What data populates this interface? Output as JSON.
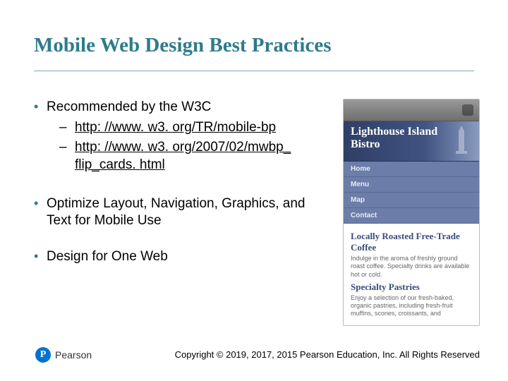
{
  "title": "Mobile Web Design Best Practices",
  "bullets": {
    "b1": {
      "text": "Recommended by the W3C",
      "links": {
        "l1": "http: //www. w3. org/TR/mobile-bp",
        "l2a": "http: //www. w3. org/2007/02/mwbp_",
        "l2b": "flip_cards. html"
      }
    },
    "b2": "Optimize Layout, Navigation, Graphics, and Text for Mobile Use",
    "b3": "Design for One Web"
  },
  "phone": {
    "heroLine1": "Lighthouse Island",
    "heroLine2": "Bistro",
    "nav": {
      "n1": "Home",
      "n2": "Menu",
      "n3": "Map",
      "n4": "Contact"
    },
    "section1": {
      "heading": "Locally Roasted Free-Trade Coffee",
      "body": "Indulge in the aroma of freshly ground roast coffee. Specialty drinks are available hot or cold."
    },
    "section2": {
      "heading": "Specialty Pastries",
      "body": "Enjoy a selection of our fresh-baked, organic pastries, including fresh-fruit muffins, scones, croissants, and"
    }
  },
  "footer": {
    "brand": "Pearson",
    "badge": "P",
    "copyright": "Copyright © 2019, 2017, 2015 Pearson Education, Inc. All Rights Reserved"
  }
}
